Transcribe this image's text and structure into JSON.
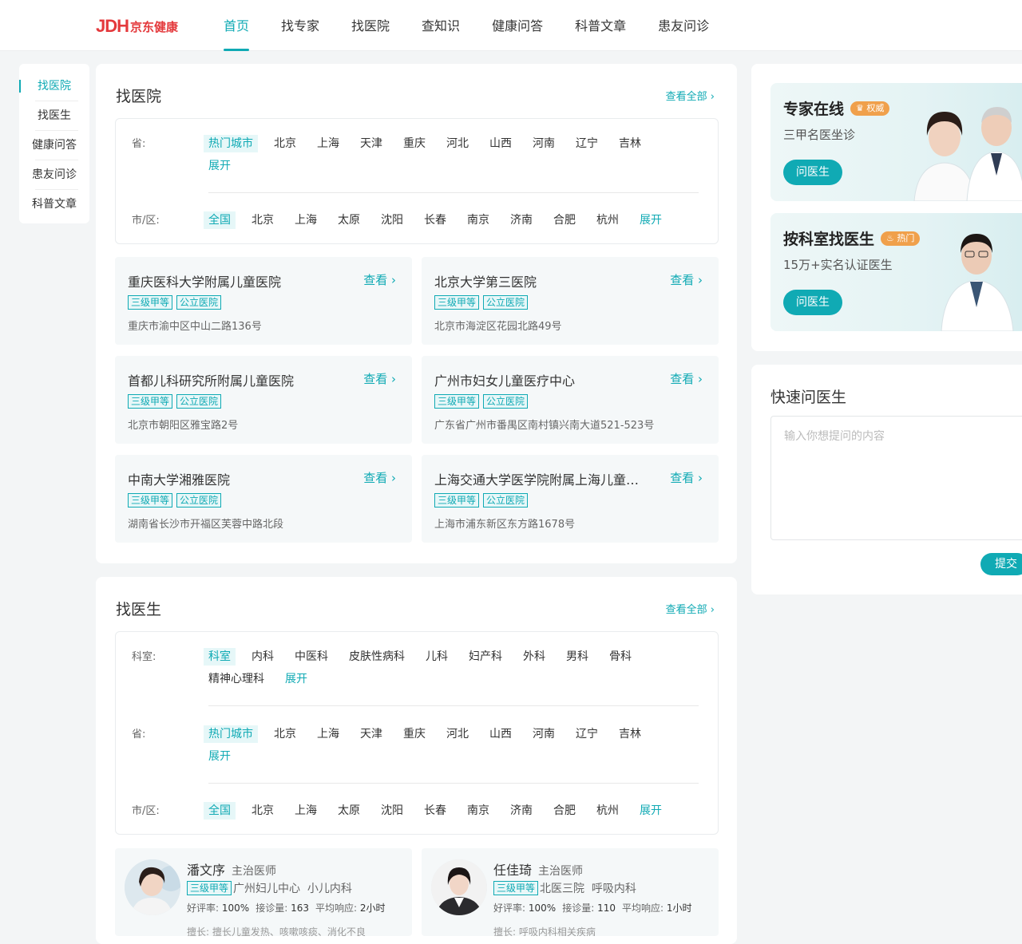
{
  "header": {
    "logo_mark": "JDH",
    "logo_text": "京东健康",
    "nav": [
      "首页",
      "找专家",
      "找医院",
      "查知识",
      "健康问答",
      "科普文章",
      "患友问诊"
    ]
  },
  "leftnav": {
    "items": [
      "找医院",
      "找医生",
      "健康问答",
      "患友问诊",
      "科普文章"
    ]
  },
  "find_hospital": {
    "title": "找医院",
    "view_all": "查看全部",
    "province_label": "省:",
    "provinces": [
      "热门城市",
      "北京",
      "上海",
      "天津",
      "重庆",
      "河北",
      "山西",
      "河南",
      "辽宁",
      "吉林",
      "展开"
    ],
    "city_label": "市/区:",
    "cities": [
      "全国",
      "北京",
      "上海",
      "太原",
      "沈阳",
      "长春",
      "南京",
      "济南",
      "合肥",
      "杭州",
      "展开"
    ],
    "view_label": "查看",
    "hospitals": [
      {
        "name": "重庆医科大学附属儿童医院",
        "tags": [
          "三级甲等",
          "公立医院"
        ],
        "address": "重庆市渝中区中山二路136号"
      },
      {
        "name": "北京大学第三医院",
        "tags": [
          "三级甲等",
          "公立医院"
        ],
        "address": "北京市海淀区花园北路49号"
      },
      {
        "name": "首都儿科研究所附属儿童医院",
        "tags": [
          "三级甲等",
          "公立医院"
        ],
        "address": "北京市朝阳区雅宝路2号"
      },
      {
        "name": "广州市妇女儿童医疗中心",
        "tags": [
          "三级甲等",
          "公立医院"
        ],
        "address": "广东省广州市番禺区南村镇兴南大道521-523号"
      },
      {
        "name": "中南大学湘雅医院",
        "tags": [
          "三级甲等",
          "公立医院"
        ],
        "address": "湖南省长沙市开福区芙蓉中路北段"
      },
      {
        "name": "上海交通大学医学院附属上海儿童医学中心",
        "tags": [
          "三级甲等",
          "公立医院"
        ],
        "address": "上海市浦东新区东方路1678号"
      }
    ]
  },
  "find_doctor": {
    "title": "找医生",
    "view_all": "查看全部",
    "dept_label": "科室:",
    "depts": [
      "科室",
      "内科",
      "中医科",
      "皮肤性病科",
      "儿科",
      "妇产科",
      "外科",
      "男科",
      "骨科",
      "精神心理科",
      "展开"
    ],
    "province_label": "省:",
    "provinces": [
      "热门城市",
      "北京",
      "上海",
      "天津",
      "重庆",
      "河北",
      "山西",
      "河南",
      "辽宁",
      "吉林",
      "展开"
    ],
    "city_label": "市/区:",
    "cities": [
      "全国",
      "北京",
      "上海",
      "太原",
      "沈阳",
      "长春",
      "南京",
      "济南",
      "合肥",
      "杭州",
      "展开"
    ],
    "doctors": [
      {
        "name": "潘文序",
        "title": "主治医师",
        "tag": "三级甲等",
        "hospital": "广州妇儿中心",
        "dept": "小儿内科",
        "rating_label": "好评率:",
        "rating": "100%",
        "consults_label": "接诊量:",
        "consults": "163",
        "response_label": "平均响应:",
        "response": "2小时",
        "skill": "擅长: 擅长儿童发热、咳嗽咳痰、消化不良"
      },
      {
        "name": "任佳琦",
        "title": "主治医师",
        "tag": "三级甲等",
        "hospital": "北医三院",
        "dept": "呼吸内科",
        "rating_label": "好评率:",
        "rating": "100%",
        "consults_label": "接诊量:",
        "consults": "110",
        "response_label": "平均响应:",
        "response": "1小时",
        "skill": "擅长: 呼吸内科相关疾病"
      }
    ]
  },
  "promos": [
    {
      "title": "专家在线",
      "badge": "权威",
      "subtitle": "三甲名医坐诊",
      "button": "问医生"
    },
    {
      "title": "按科室找医生",
      "badge": "热门",
      "subtitle": "15万+实名认证医生",
      "button": "问医生"
    }
  ],
  "quick_ask": {
    "title": "快速问医生",
    "placeholder": "输入你想提问的内容",
    "submit": "提交"
  },
  "colors": {
    "accent": "#10aab4",
    "brand": "#e4393c",
    "badge": "#f0a04b"
  }
}
